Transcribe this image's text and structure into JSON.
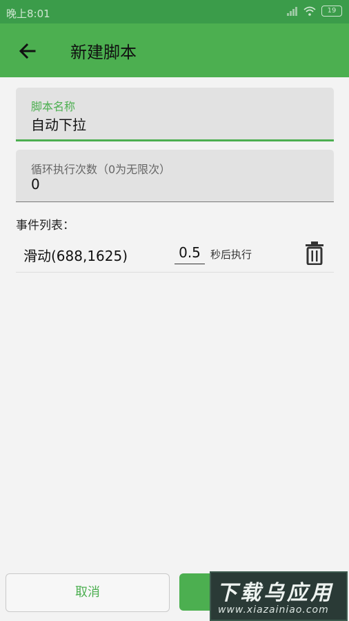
{
  "status": {
    "time": "晚上8:01",
    "battery": "19"
  },
  "appbar": {
    "title": "新建脚本"
  },
  "form": {
    "name": {
      "label": "脚本名称",
      "value": "自动下拉"
    },
    "loop": {
      "label": "循环执行次数（0为无限次）",
      "value": "0"
    }
  },
  "events": {
    "title": "事件列表：",
    "items": [
      {
        "name": "滑动(688,1625)",
        "delay": "0.5",
        "suffix": "秒后执行"
      }
    ]
  },
  "buttons": {
    "cancel": "取消"
  },
  "watermark": {
    "main": "下载乌应用",
    "sub": "www.xiazainiao.com"
  }
}
